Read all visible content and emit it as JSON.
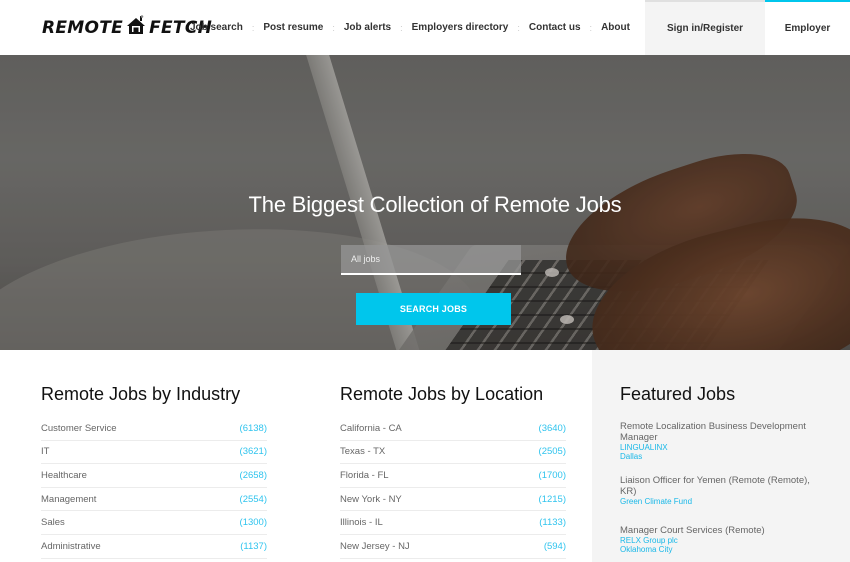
{
  "header": {
    "logo": {
      "left": "REMOTE",
      "right": "FETCH",
      "icon": "house-icon"
    },
    "nav": [
      "Job search",
      "Post resume",
      "Job alerts",
      "Employers directory",
      "Contact us",
      "About"
    ],
    "nav_separator": ":",
    "signin_label": "Sign in/Register",
    "employer_label": "Employer"
  },
  "colors": {
    "accent": "#00c6ec",
    "link": "#30c4ee",
    "panel": "#f4f4f4"
  },
  "hero": {
    "title": "The Biggest Collection of Remote Jobs",
    "search_placeholder": "All jobs",
    "search_value": "",
    "button_label": "SEARCH JOBS"
  },
  "industry": {
    "title": "Remote Jobs by Industry",
    "items": [
      {
        "name": "Customer Service",
        "count": "(6138)"
      },
      {
        "name": "IT",
        "count": "(3621)"
      },
      {
        "name": "Healthcare",
        "count": "(2658)"
      },
      {
        "name": "Management",
        "count": "(2554)"
      },
      {
        "name": "Sales",
        "count": "(1300)"
      },
      {
        "name": "Administrative",
        "count": "(1137)"
      }
    ]
  },
  "location": {
    "title": "Remote Jobs by Location",
    "items": [
      {
        "name": "California - CA",
        "count": "(3640)"
      },
      {
        "name": "Texas - TX",
        "count": "(2505)"
      },
      {
        "name": "Florida - FL",
        "count": "(1700)"
      },
      {
        "name": "New York - NY",
        "count": "(1215)"
      },
      {
        "name": "Illinois - IL",
        "count": "(1133)"
      },
      {
        "name": "New Jersey - NJ",
        "count": "(594)"
      }
    ]
  },
  "featured": {
    "title": "Featured Jobs",
    "jobs": [
      {
        "title": "Remote Localization Business Development Manager",
        "company": "LINGUALINX",
        "location": "Dallas"
      },
      {
        "title": "Liaison Officer for Yemen (Remote (Remote), KR)",
        "company": "Green Climate Fund",
        "location": ""
      },
      {
        "title": "Manager Court Services (Remote)",
        "company": "RELX Group plc",
        "location": "Oklahoma City"
      }
    ]
  }
}
